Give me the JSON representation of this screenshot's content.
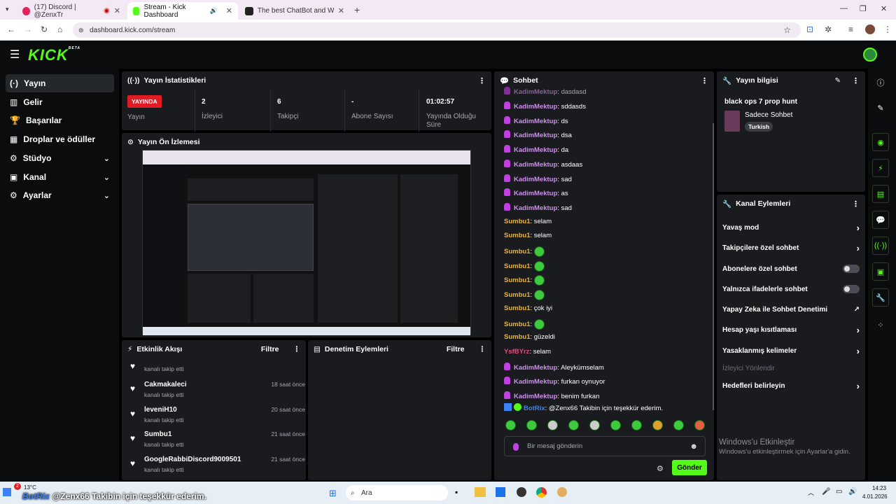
{
  "browser": {
    "tabs": [
      {
        "title": "(17) Discord | @ZenxTr",
        "active": false
      },
      {
        "title": "Stream - Kick Dashboard",
        "active": true
      },
      {
        "title": "The best ChatBot and Widgets",
        "active": false
      }
    ],
    "url": "dashboard.kick.com/stream"
  },
  "app": {
    "logo": "KICK",
    "logo_badge": "BETA"
  },
  "sidebar": {
    "items": [
      {
        "label": "Yayın",
        "icon": "broadcast-icon",
        "selected": true
      },
      {
        "label": "Gelir",
        "icon": "revenue-icon"
      },
      {
        "label": "Başarılar",
        "icon": "trophy-icon"
      },
      {
        "label": "Droplar ve ödüller",
        "icon": "gift-icon"
      },
      {
        "label": "Stüdyo",
        "icon": "studio-icon",
        "expandable": true
      },
      {
        "label": "Kanal",
        "icon": "channel-icon",
        "expandable": true
      },
      {
        "label": "Ayarlar",
        "icon": "settings-icon",
        "expandable": true
      }
    ]
  },
  "stats": {
    "title": "Yayın İstatistikleri",
    "live_badge": "YAYINDA",
    "live_label": "Yayın",
    "viewers_value": "2",
    "viewers_label": "İzleyici",
    "followers_value": "6",
    "followers_label": "Takipçi",
    "subs_value": "-",
    "subs_label": "Abone Sayısı",
    "uptime_value": "01:02:57",
    "uptime_label": "Yayında Olduğu Süre"
  },
  "preview": {
    "title": "Yayın Ön İzlemesi"
  },
  "activity": {
    "title": "Etkinlik Akışı",
    "filter": "Filtre",
    "items": [
      {
        "name": "Cakmakaleci",
        "action": "kanalı takip etti",
        "time": "18 saat önce"
      },
      {
        "name": "leveniH10",
        "action": "kanalı takip etti",
        "time": "20 saat önce"
      },
      {
        "name": "Sumbu1",
        "action": "kanalı takip etti",
        "time": "21 saat önce"
      },
      {
        "name": "GoogleRabbiDiscord9009501",
        "action": "kanalı takip etti",
        "time": "21 saat önce"
      }
    ]
  },
  "moderation": {
    "title": "Denetim Eylemleri",
    "filter": "Filtre"
  },
  "chat": {
    "title": "Sohbet",
    "messages": [
      {
        "user": "KadimMektup",
        "text": "sddasds",
        "type": "kadim"
      },
      {
        "user": "KadimMektup",
        "text": "ds",
        "type": "kadim"
      },
      {
        "user": "KadimMektup",
        "text": "dsa",
        "type": "kadim"
      },
      {
        "user": "KadimMektup",
        "text": "da",
        "type": "kadim"
      },
      {
        "user": "KadimMektup",
        "text": "asdaas",
        "type": "kadim"
      },
      {
        "user": "KadimMektup",
        "text": "sad",
        "type": "kadim"
      },
      {
        "user": "KadimMektup",
        "text": "as",
        "type": "kadim"
      },
      {
        "user": "KadimMektup",
        "text": "sad",
        "type": "kadim"
      },
      {
        "user": "Sumbu1",
        "text": "selam",
        "type": "sumbu"
      },
      {
        "user": "Sumbu1",
        "text": "selam",
        "type": "sumbu"
      },
      {
        "user": "Sumbu1",
        "text": "",
        "type": "sumbu",
        "emote": true
      },
      {
        "user": "Sumbu1",
        "text": "",
        "type": "sumbu",
        "emote": true
      },
      {
        "user": "Sumbu1",
        "text": "",
        "type": "sumbu",
        "emote": true
      },
      {
        "user": "Sumbu1",
        "text": "",
        "type": "sumbu",
        "emote": true
      },
      {
        "user": "Sumbu1",
        "text": "çok iyi",
        "type": "sumbu"
      },
      {
        "user": "Sumbu1",
        "text": "",
        "type": "sumbu",
        "emote": true
      },
      {
        "user": "Sumbu1",
        "text": "güzeldi",
        "type": "sumbu"
      },
      {
        "user": "YsfBYrz",
        "text": "selam",
        "type": "ysf"
      },
      {
        "user": "KadimMektup",
        "text": "Aleykümselam",
        "type": "kadim"
      },
      {
        "user": "KadimMektup",
        "text": "furkan oynuyor",
        "type": "kadim"
      },
      {
        "user": "KadimMektup",
        "text": "benim furkan",
        "type": "kadim"
      },
      {
        "user": "BotRix",
        "text": "@Zenx66 Takibin için teşekkür ederim.",
        "type": "bot"
      }
    ],
    "input_placeholder": "Bir mesaj gönderin",
    "send_label": "Gönder"
  },
  "stream_info": {
    "title": "Yayın bilgisi",
    "stream_title": "black ops 7 prop hunt",
    "category": "Sadece Sohbet",
    "tag": "Turkish"
  },
  "channel_actions": {
    "title": "Kanal Eylemleri",
    "items": [
      {
        "label": "Yavaş mod",
        "control": "arrow"
      },
      {
        "label": "Takipçilere özel sohbet",
        "control": "arrow"
      },
      {
        "label": "Abonelere özel sohbet",
        "control": "toggle"
      },
      {
        "label": "Yalnızca ifadelerle sohbet",
        "control": "toggle"
      },
      {
        "label": "Yapay Zeka ile Sohbet Denetimi",
        "control": "external"
      },
      {
        "label": "Hesap yaşı kısıtlaması",
        "control": "arrow"
      },
      {
        "label": "Yasaklanmış kelimeler",
        "control": "arrow"
      },
      {
        "label": "İzleyici Yönlendir",
        "control": "none",
        "disabled": true
      },
      {
        "label": "Hedefleri belirleyin",
        "control": "arrow"
      }
    ]
  },
  "watermark": {
    "line1": "Windows'u Etkinleştir",
    "line2": "Windows'u etkinleştirmek için Ayarlar'a gidin."
  },
  "taskbar": {
    "weather": "13°C",
    "overlay": "@Zenx66 Takibin için teşekkür ederim.",
    "search": "Ara",
    "time": "14:23",
    "date": "4.01.2026"
  }
}
